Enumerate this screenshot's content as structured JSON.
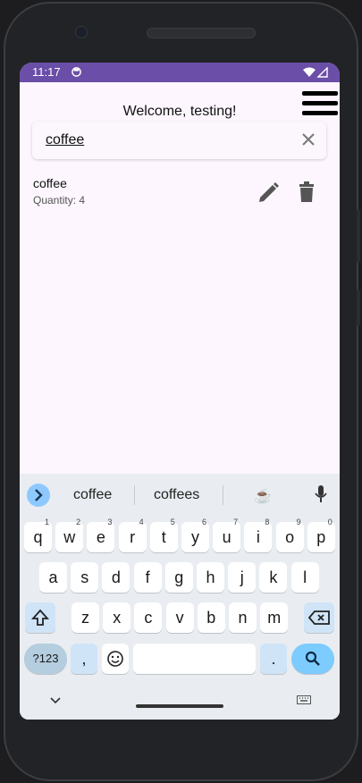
{
  "status": {
    "time": "11:17"
  },
  "header": {
    "welcome": "Welcome, testing!"
  },
  "search": {
    "value": "coffee"
  },
  "items": [
    {
      "name": "coffee",
      "quantity": "Quantity: 4"
    }
  ],
  "keyboard": {
    "suggestions": [
      "coffee",
      "coffees",
      "☕"
    ],
    "row1": [
      "q",
      "w",
      "e",
      "r",
      "t",
      "y",
      "u",
      "i",
      "o",
      "p"
    ],
    "row1_digits": [
      "1",
      "2",
      "3",
      "4",
      "5",
      "6",
      "7",
      "8",
      "9",
      "0"
    ],
    "row2": [
      "a",
      "s",
      "d",
      "f",
      "g",
      "h",
      "j",
      "k",
      "l"
    ],
    "row3": [
      "z",
      "x",
      "c",
      "v",
      "b",
      "n",
      "m"
    ],
    "symbols_label": "?123",
    "comma": ",",
    "period": "."
  },
  "colors": {
    "statusbar": "#6a4ea8",
    "screen_bg": "#fdf6ff",
    "keyboard_bg": "#e9edf1",
    "accent": "#7dccff"
  }
}
